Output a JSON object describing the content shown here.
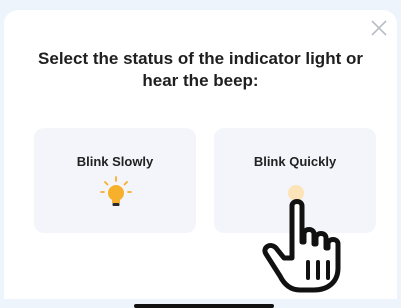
{
  "dialog": {
    "title": "Select the status of the indicator light or hear the beep:",
    "options": [
      {
        "label": "Blink Slowly",
        "icon": "lightbulb-icon"
      },
      {
        "label": "Blink Quickly",
        "icon": "lightbulb-icon"
      }
    ]
  },
  "colors": {
    "background": "#eef4fb",
    "card": "#f3f5fb",
    "bulb": "#f7b02b",
    "bulb_dim": "#fde3b8"
  }
}
